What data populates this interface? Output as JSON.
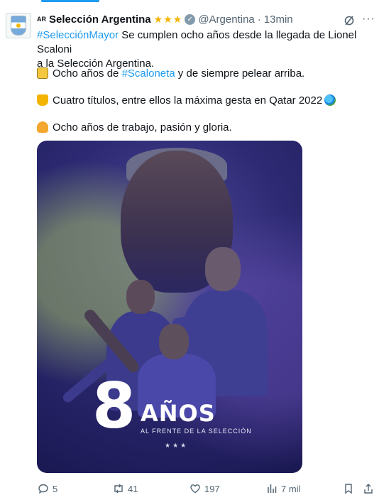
{
  "tweet": {
    "flag_code": "AR",
    "display_name": "Selección Argentina",
    "stars": "★★★",
    "handle": "@Argentina",
    "separator": "·",
    "time": "13min",
    "line1_hashtag": "#SelecciónMayor",
    "line1_text": " Se cumplen ocho años desde la llegada de Lionel Scaloni",
    "line2_text": "a la Selección Argentina.",
    "para2_prefix": "Ocho años de ",
    "para2_hashtag": "#Scaloneta",
    "para2_suffix": " y de siempre pelear arriba.",
    "para3_text": "Cuatro títulos, entre ellos la máxima gesta en Qatar 2022",
    "para4_text": "Ocho años de trabajo, pasión y gloria."
  },
  "media": {
    "number": "8",
    "word": "AÑOS",
    "subtitle": "AL FRENTE DE LA SELECCIÓN",
    "stars": "★★★"
  },
  "actions": {
    "replies": "5",
    "reposts": "41",
    "likes": "197",
    "views": "7 mil"
  },
  "colors": {
    "accent": "#1d9bf0",
    "muted": "#536471",
    "star": "#f4b400"
  }
}
